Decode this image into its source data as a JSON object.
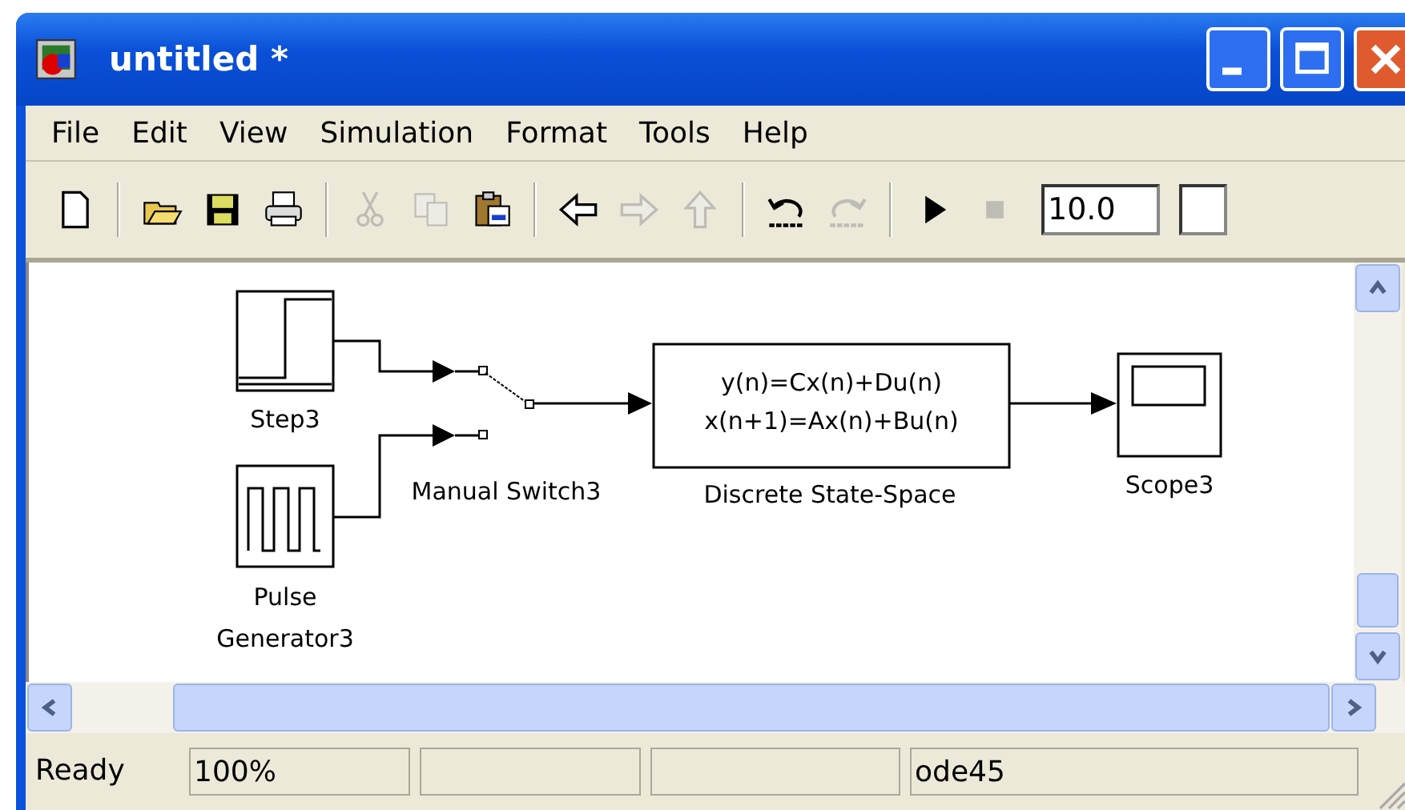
{
  "window": {
    "title": "untitled *"
  },
  "menu": [
    "File",
    "Edit",
    "View",
    "Simulation",
    "Format",
    "Tools",
    "Help"
  ],
  "toolbar": [
    {
      "kind": "new",
      "disabled": false
    },
    {
      "kind": "sep"
    },
    {
      "kind": "open",
      "disabled": false
    },
    {
      "kind": "save",
      "disabled": false
    },
    {
      "kind": "print",
      "disabled": false
    },
    {
      "kind": "sep"
    },
    {
      "kind": "cut",
      "disabled": true
    },
    {
      "kind": "copy",
      "disabled": true
    },
    {
      "kind": "paste",
      "disabled": false
    },
    {
      "kind": "sep"
    },
    {
      "kind": "back",
      "disabled": false
    },
    {
      "kind": "forward",
      "disabled": true
    },
    {
      "kind": "up",
      "disabled": true
    },
    {
      "kind": "sep"
    },
    {
      "kind": "undo",
      "disabled": false
    },
    {
      "kind": "redo",
      "disabled": true
    },
    {
      "kind": "sep"
    },
    {
      "kind": "start",
      "disabled": false
    },
    {
      "kind": "stop",
      "disabled": true
    }
  ],
  "stop_time": {
    "value": "10.0"
  },
  "blocks": [
    {
      "kind": "step",
      "label": "Step3"
    },
    {
      "kind": "pulse",
      "label": [
        "Pulse",
        "Generator3"
      ]
    },
    {
      "kind": "switch",
      "label": "Manual Switch3"
    },
    {
      "kind": "state_space",
      "lines": [
        "y(n)=Cx(n)+Du(n)",
        "x(n+1)=Ax(n)+Bu(n)"
      ],
      "label": "Discrete State-Space"
    },
    {
      "kind": "scope",
      "label": "Scope3"
    }
  ],
  "status_bar": {
    "state": "Ready",
    "zoom": "100%",
    "solver": "ode45"
  }
}
